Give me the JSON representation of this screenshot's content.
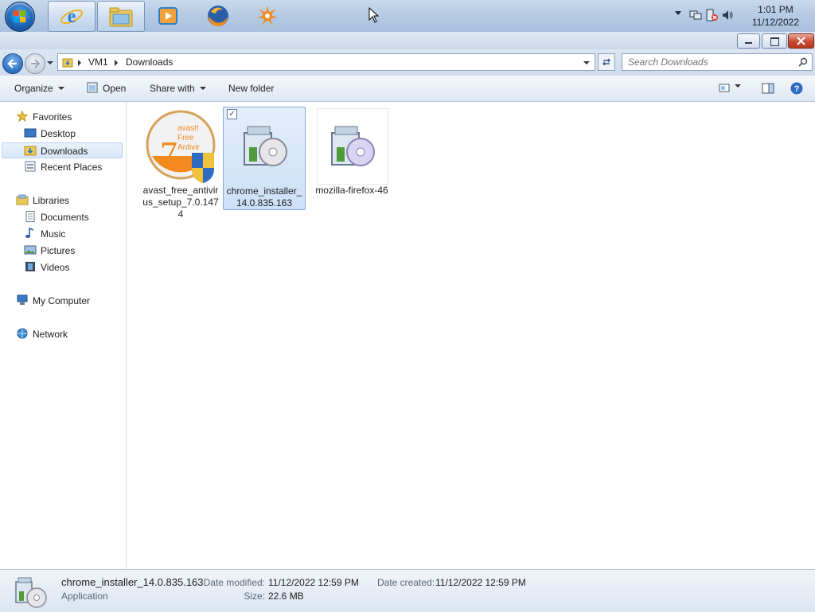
{
  "taskbar": {
    "apps": [
      {
        "name": "internet-explorer",
        "active": true
      },
      {
        "name": "windows-explorer",
        "active": true
      },
      {
        "name": "media-player",
        "active": false
      },
      {
        "name": "firefox",
        "active": false
      },
      {
        "name": "avast",
        "active": false
      }
    ],
    "clock": {
      "time": "1:01 PM",
      "date": "11/12/2022"
    }
  },
  "address": {
    "crumbs": [
      "VM1",
      "Downloads"
    ],
    "search_placeholder": "Search Downloads"
  },
  "commands": {
    "organize": "Organize",
    "open": "Open",
    "share_with": "Share with",
    "new_folder": "New folder"
  },
  "navpane": {
    "favorites": "Favorites",
    "desktop": "Desktop",
    "downloads": "Downloads",
    "recent_places": "Recent Places",
    "libraries": "Libraries",
    "documents": "Documents",
    "music": "Music",
    "pictures": "Pictures",
    "videos": "Videos",
    "my_computer": "My Computer",
    "network": "Network"
  },
  "files": [
    {
      "label": "avast_free_antivirus_setup_7.0.1474",
      "selected": false,
      "thumb_text": [
        "avast!",
        "Free",
        "Antivir"
      ],
      "thumb_number": "7"
    },
    {
      "label": "chrome_installer_14.0.835.163",
      "selected": true
    },
    {
      "label": "mozilla-firefox-46",
      "selected": false
    }
  ],
  "details": {
    "name": "chrome_installer_14.0.835.163",
    "type": "Application",
    "date_modified_label": "Date modified:",
    "date_modified": "11/12/2022 12:59 PM",
    "size_label": "Size:",
    "size": "22.6 MB",
    "date_created_label": "Date created:",
    "date_created": "11/12/2022 12:59 PM"
  },
  "colors": {
    "accent": "#3b78c4",
    "selection": "#cce0f7",
    "close_button": "#c74a2f"
  }
}
